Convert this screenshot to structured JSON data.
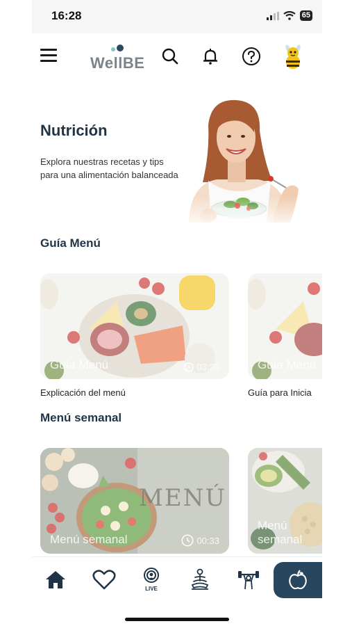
{
  "status_bar": {
    "time": "16:28",
    "battery": "65"
  },
  "header": {
    "logo_text": "WellBE"
  },
  "hero": {
    "title": "Nutrición",
    "subtitle": "Explora nuestras recetas y tips para una alimentación balanceada"
  },
  "sections": {
    "guide": {
      "title": "Guía Menú",
      "cards": [
        {
          "label": "Guía Menú",
          "duration": "03:20",
          "caption": "Explicación del menú"
        },
        {
          "label": "Guía Menú",
          "caption": "Guía para Inicia"
        }
      ]
    },
    "weekly": {
      "title": "Menú semanal",
      "cards": [
        {
          "label": "Menú semanal",
          "duration": "00:33",
          "overlay_text": "MENÚ"
        },
        {
          "label": "Menú semanal"
        }
      ]
    }
  },
  "bottom_nav": {
    "items": [
      "home-icon",
      "heart-icon",
      "live-icon",
      "meditation-icon",
      "fitness-icon",
      "apple-icon"
    ],
    "live_label": "LIVE",
    "active": "apple-icon"
  },
  "colors": {
    "primary": "#1f3447",
    "accent_nav": "#28465e",
    "logo_grey": "#7b848c"
  }
}
